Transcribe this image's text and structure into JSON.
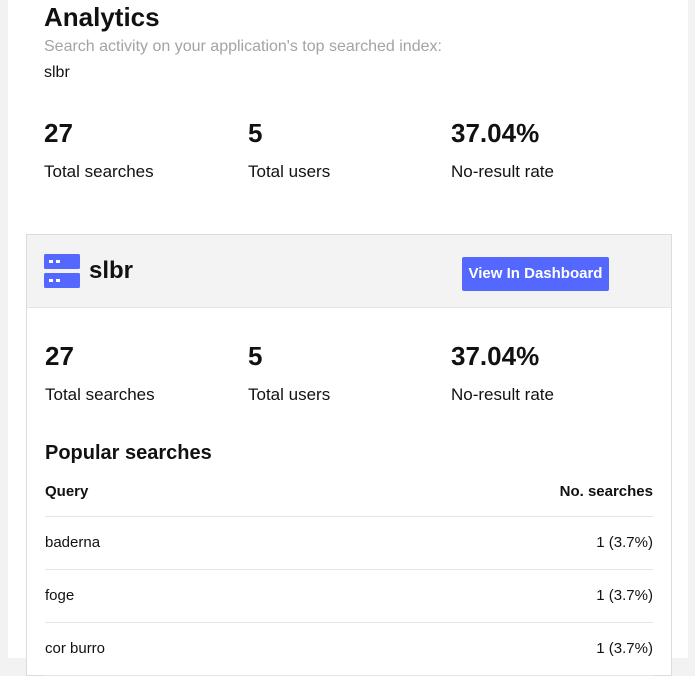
{
  "header": {
    "title": "Analytics",
    "subtitle": "Search activity on your application's top searched index:",
    "index_name": "slbr"
  },
  "summary_stats": [
    {
      "value": "27",
      "label": "Total searches"
    },
    {
      "value": "5",
      "label": "Total users"
    },
    {
      "value": "37.04%",
      "label": "No-result rate"
    }
  ],
  "card": {
    "icon": "database-icon",
    "title": "slbr",
    "button_label": "View In Dashboard",
    "accent_color": "#5468ff",
    "stats": [
      {
        "value": "27",
        "label": "Total searches"
      },
      {
        "value": "5",
        "label": "Total users"
      },
      {
        "value": "37.04%",
        "label": "No-result rate"
      }
    ],
    "popular": {
      "title": "Popular searches",
      "columns": [
        "Query",
        "No. searches"
      ],
      "rows": [
        {
          "query": "baderna",
          "count": "1 (3.7%)"
        },
        {
          "query": "foge",
          "count": "1 (3.7%)"
        },
        {
          "query": "cor burro",
          "count": "1 (3.7%)"
        }
      ]
    }
  }
}
